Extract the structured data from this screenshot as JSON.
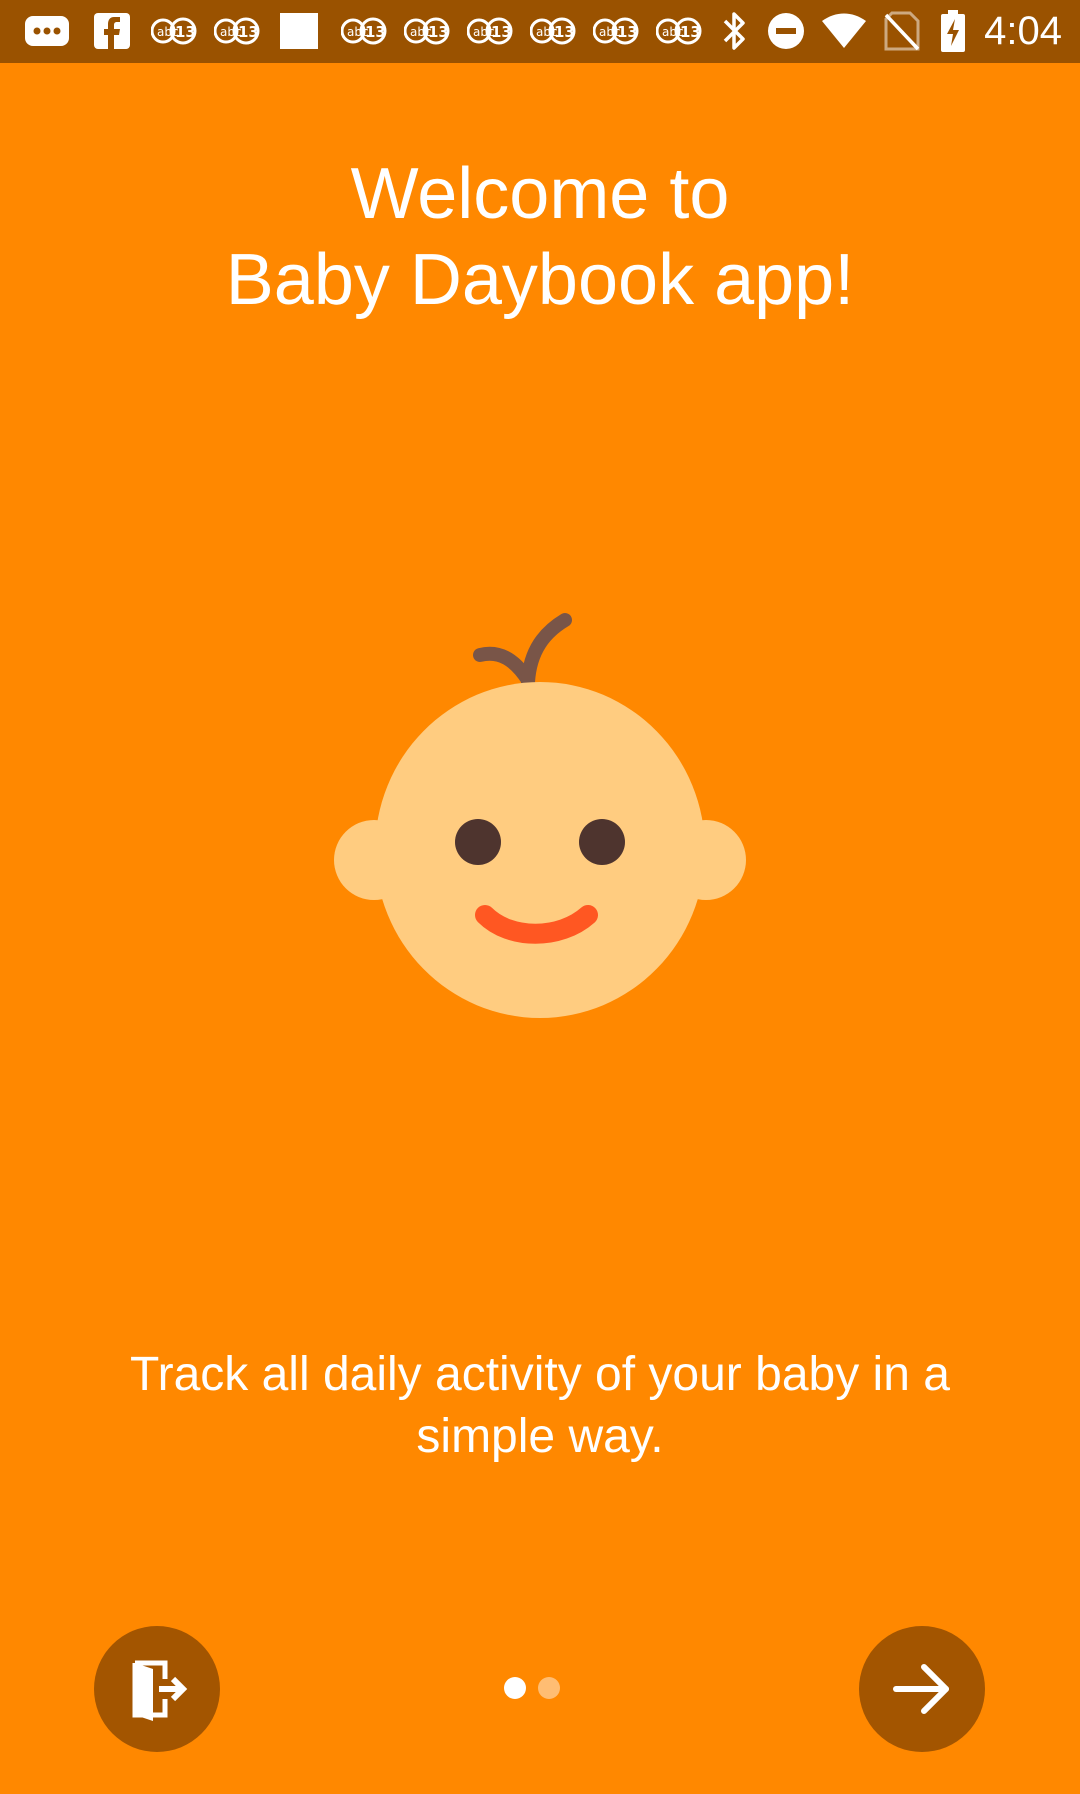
{
  "status_bar": {
    "time": "4:04",
    "icons": [
      "more-icon",
      "facebook-icon",
      "news-icon",
      "news-icon",
      "square-icon",
      "news-icon",
      "news-icon",
      "news-icon",
      "news-icon",
      "news-icon",
      "news-icon",
      "bluetooth-icon",
      "do-not-disturb-icon",
      "wifi-icon",
      "no-sim-icon",
      "battery-charging-icon"
    ]
  },
  "welcome": {
    "title_line1": "Welcome to",
    "title_line2": "Baby Daybook app!"
  },
  "illustration": {
    "icon": "baby-face-icon",
    "colors": {
      "face": "#FFCC80",
      "hair": "#795548",
      "eyes": "#4E342E",
      "mouth": "#FF5722"
    }
  },
  "description": {
    "line1": "Track all daily activity of your baby in a",
    "line2": "simple way."
  },
  "pager": {
    "current_page": 1,
    "total_pages": 2
  },
  "buttons": {
    "skip_icon": "exit-door-icon",
    "next_icon": "arrow-right-icon"
  },
  "colors": {
    "background": "#FF8800",
    "status_bar": "#9A5200",
    "button": "#A35500",
    "text": "#FFFFFF"
  }
}
